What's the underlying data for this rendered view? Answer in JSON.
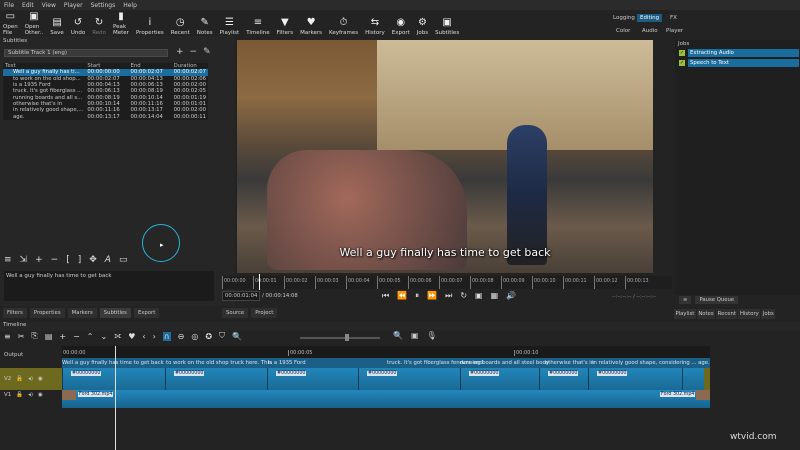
{
  "menu": [
    "File",
    "Edit",
    "View",
    "Player",
    "Settings",
    "Help"
  ],
  "toolbar": [
    {
      "label": "Open File",
      "icon": "folder-icon",
      "glyph": "▭"
    },
    {
      "label": "Open Other..",
      "icon": "open-other-icon",
      "glyph": "▣"
    },
    {
      "label": "Save",
      "icon": "save-icon",
      "glyph": "▤"
    },
    {
      "label": "Undo",
      "icon": "undo-icon",
      "glyph": "↺"
    },
    {
      "label": "Redo",
      "icon": "redo-icon",
      "glyph": "↻",
      "disabled": true
    },
    {
      "label": "Peak Meter",
      "icon": "peak-meter-icon",
      "glyph": "▮"
    },
    {
      "label": "Properties",
      "icon": "info-icon",
      "glyph": "i"
    },
    {
      "label": "Recent",
      "icon": "clock-icon",
      "glyph": "◷"
    },
    {
      "label": "Notes",
      "icon": "notes-icon",
      "glyph": "✎"
    },
    {
      "label": "Playlist",
      "icon": "list-icon",
      "glyph": "☰"
    },
    {
      "label": "Timeline",
      "icon": "timeline-icon",
      "glyph": "≡"
    },
    {
      "label": "Filters",
      "icon": "filter-icon",
      "glyph": "▼"
    },
    {
      "label": "Markers",
      "icon": "marker-icon",
      "glyph": "♥"
    },
    {
      "label": "Keyframes",
      "icon": "stopwatch-icon",
      "glyph": "⏱"
    },
    {
      "label": "History",
      "icon": "history-icon",
      "glyph": "⇆"
    },
    {
      "label": "Export",
      "icon": "export-icon",
      "glyph": "◉"
    },
    {
      "label": "Jobs",
      "icon": "gear-icon",
      "glyph": "⚙"
    },
    {
      "label": "Subtitles",
      "icon": "subtitles-icon",
      "glyph": "▣"
    }
  ],
  "layouts": {
    "row1": [
      "Logging",
      "Editing",
      "FX"
    ],
    "row2": [
      "Color",
      "Audio",
      "Player"
    ],
    "active": "Editing"
  },
  "subtitles": {
    "title": "Subtitles",
    "track": "Subtitle Track 1 (eng)",
    "columns": [
      "Text",
      "Start",
      "End",
      "Duration"
    ],
    "rows": [
      [
        "Well a guy finally has ti...",
        "00:00:00:00",
        "00:00:02:07",
        "00:00:02:07"
      ],
      [
        "to work on the old shop...",
        "00:00:02:07",
        "00:00:04:13",
        "00:00:02:06"
      ],
      [
        "is a 1935 Ford",
        "00:00:04:13",
        "00:00:06:13",
        "00:00:02:00"
      ],
      [
        "truck. It's got fiberglass ...",
        "00:00:06:13",
        "00:00:08:19",
        "00:00:02:05"
      ],
      [
        "running boards and all s...",
        "00:00:08:19",
        "00:00:10:14",
        "00:00:01:19"
      ],
      [
        "otherwise that's in",
        "00:00:10:14",
        "00:00:11:16",
        "00:00:01:01"
      ],
      [
        "in relatively good shape,...",
        "00:00:11:16",
        "00:00:13:17",
        "00:00:02:00"
      ],
      [
        "age.",
        "00:00:13:17",
        "00:00:14:04",
        "00:00:00:11"
      ]
    ],
    "selected_row": 0,
    "edit_text": "Well a guy finally has time to get back"
  },
  "player": {
    "caption": "Well a guy finally has time to get back",
    "ruler": [
      "00:00:00",
      "00:00:01",
      "00:00:02",
      "00:00:03",
      "00:00:04",
      "00:00:05",
      "00:00:06",
      "00:00:07",
      "00:00:08",
      "00:00:09",
      "00:00:10",
      "00:00:11",
      "00:00:12",
      "00:00:13"
    ],
    "current": "00:00:01:04",
    "total": "/ 00:00:14:08",
    "inout": "--:--:--:-- / --:--:--:--"
  },
  "left_tabs": [
    "Filters",
    "Properties",
    "Markers",
    "Subtitles",
    "Export"
  ],
  "source_tabs": [
    "Source",
    "Project"
  ],
  "jobs": {
    "title": "Jobs",
    "items": [
      "Extracting Audio",
      "Speech to Text"
    ],
    "pause": "Pause Queue"
  },
  "right_tabs": [
    "Playlist",
    "Notes",
    "Recent",
    "History",
    "Jobs"
  ],
  "timeline": {
    "title": "Timeline",
    "output": "Output",
    "ruler": [
      "00:00:00",
      "00:00:05",
      "00:00:10"
    ],
    "tracks": [
      "V2",
      "V1"
    ],
    "subtitle_clips": [
      "Well a guy finally has time to get back",
      "to work on the old shop truck here. This",
      "is a 1935 Ford",
      "truck. It's got fiberglass fenders and",
      "running boards and all steel body",
      "otherwise that's in",
      "in relatively good shape, considering ... age."
    ],
    "clip_label": "#00000000",
    "v1_clip": "Ford 302.mp4"
  },
  "watermark": "wtvid.com",
  "colors": {
    "accent": "#1b6d9e",
    "clip": "#2286b9",
    "loader": "#27b3d6"
  }
}
